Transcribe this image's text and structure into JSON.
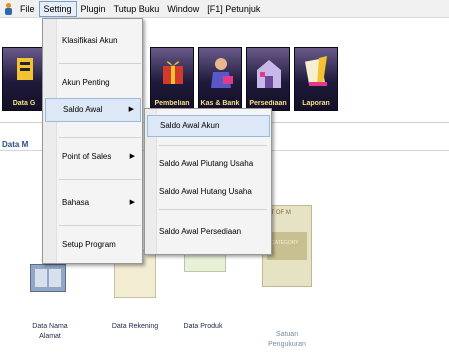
{
  "menubar": {
    "items": [
      "File",
      "Setting",
      "Plugin",
      "Tutup Buku",
      "Window",
      "[F1] Petunjuk"
    ]
  },
  "toolbar": {
    "buttons": [
      {
        "label": "Data G",
        "icon": "data-icon"
      },
      {
        "label": "Pembelian",
        "icon": "purchase-gift-icon"
      },
      {
        "label": "Kas & Bank",
        "icon": "cash-bank-icon"
      },
      {
        "label": "Persediaan",
        "icon": "inventory-icon"
      },
      {
        "label": "Laporan",
        "icon": "report-icon"
      }
    ]
  },
  "section": {
    "title": "Data M"
  },
  "content": {
    "items": [
      {
        "label_line1": "Data Nama",
        "label_line2": "Alamat",
        "icon": "address-book-icon"
      },
      {
        "label_line1": "Data Rekening",
        "label_line2": "",
        "icon": "account-icon"
      },
      {
        "label_line1": "Data Produk",
        "label_line2": "",
        "icon": "product-icon"
      },
      {
        "label_line1": "Satuan",
        "label_line2": "Pengukuran",
        "icon": "unit-measure-icon"
      }
    ],
    "partial_texts": [
      "IT OF M",
      "CATEGORY"
    ]
  },
  "dropdown": {
    "items": [
      {
        "label": "Klasifikasi Akun",
        "has_submenu": false
      },
      {
        "label": "Akun Penting",
        "has_submenu": false
      },
      {
        "label": "Saldo Awal",
        "has_submenu": true,
        "selected": true
      },
      {
        "label": "Point of Sales",
        "has_submenu": true
      },
      {
        "label": "Bahasa",
        "has_submenu": true
      },
      {
        "label": "Setup Program",
        "has_submenu": false
      }
    ],
    "arrow": "▶"
  },
  "submenu": {
    "items": [
      {
        "label": "Saldo Awal Akun",
        "selected": true
      },
      {
        "label": "Saldo Awal Piutang Usaha"
      },
      {
        "label": "Saldo Awal Hutang Usaha"
      },
      {
        "label": "Saldo Awal Persediaan"
      }
    ]
  },
  "colors": {
    "menu_highlight": "#dde8f6",
    "toolbar_bg": "#1e1a3a",
    "toolbar_label": "#f6e080",
    "section_title": "#2a4f8a"
  }
}
